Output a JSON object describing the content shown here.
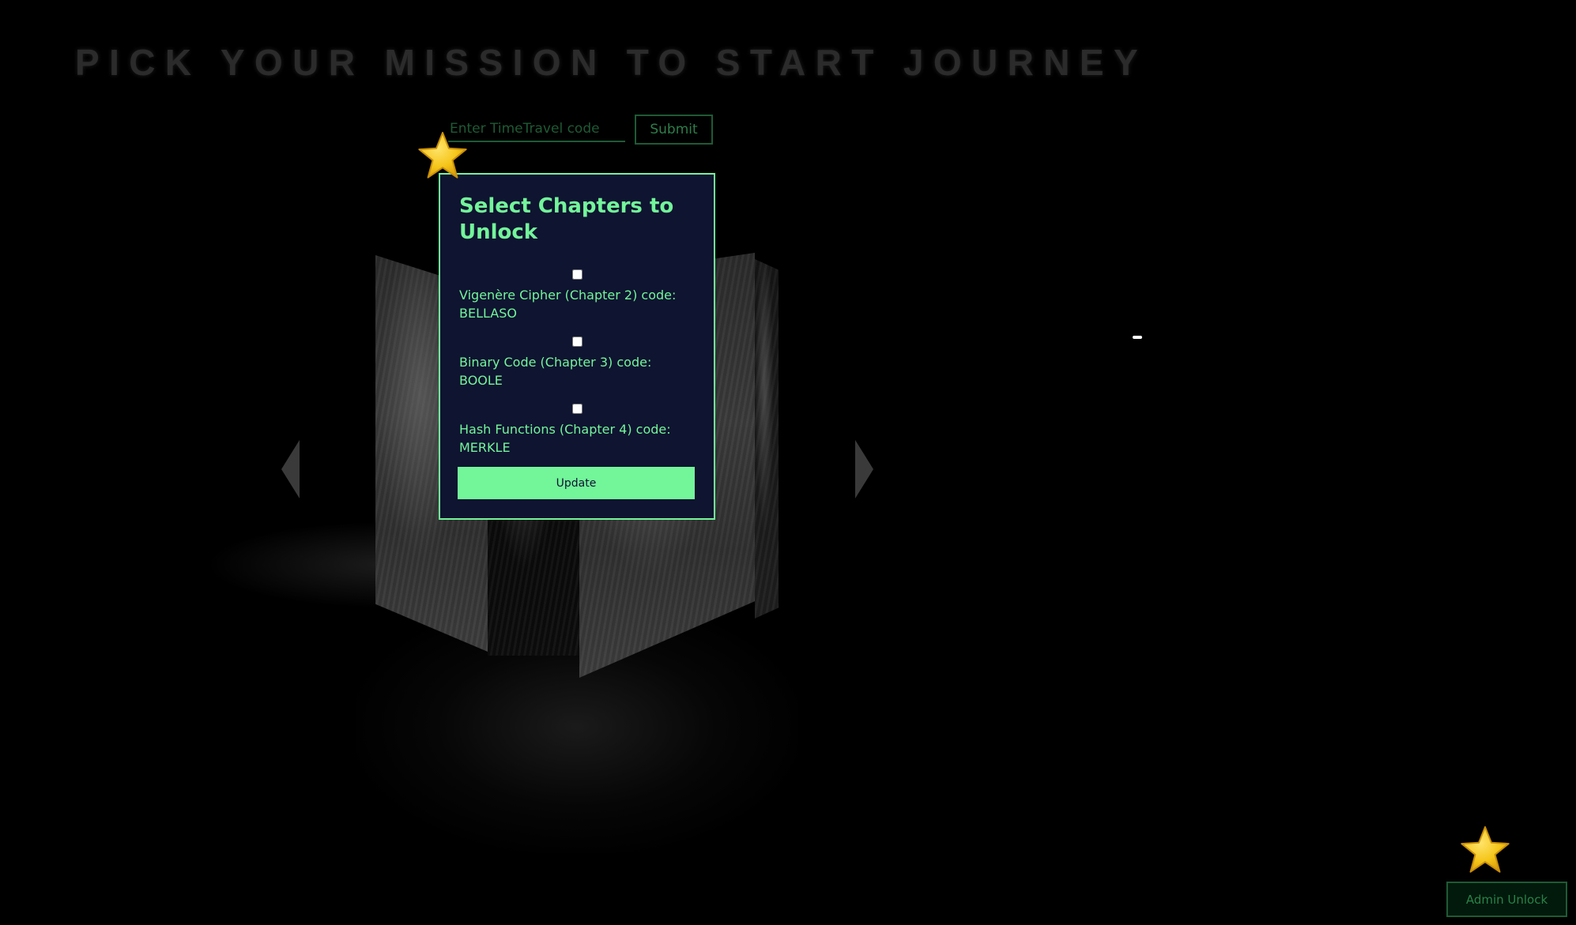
{
  "page": {
    "heading": "PICK YOUR MISSION TO START JOURNEY"
  },
  "code_form": {
    "placeholder": "Enter TimeTravel code",
    "value": "",
    "submit_label": "Submit"
  },
  "modal": {
    "title": "Select Chapters to Unlock",
    "chapters": [
      {
        "label": "Vigenère Cipher (Chapter 2) code: BELLASO",
        "checked": false
      },
      {
        "label": "Binary Code (Chapter 3) code: BOOLE",
        "checked": false
      },
      {
        "label": "Hash Functions (Chapter 4) code: MERKLE",
        "checked": false
      }
    ],
    "update_label": "Update"
  },
  "admin": {
    "button_label": "Admin Unlock"
  },
  "icons": {
    "star": "star-icon",
    "carousel_prev": "chevron-left-icon",
    "carousel_next": "chevron-right-icon"
  },
  "colors": {
    "background": "#000000",
    "accent": "#73f59a",
    "modal_background": "#0f1430",
    "muted_green": "#1f5a35",
    "heading": "#2b2b2b",
    "star": "#f5c518"
  }
}
